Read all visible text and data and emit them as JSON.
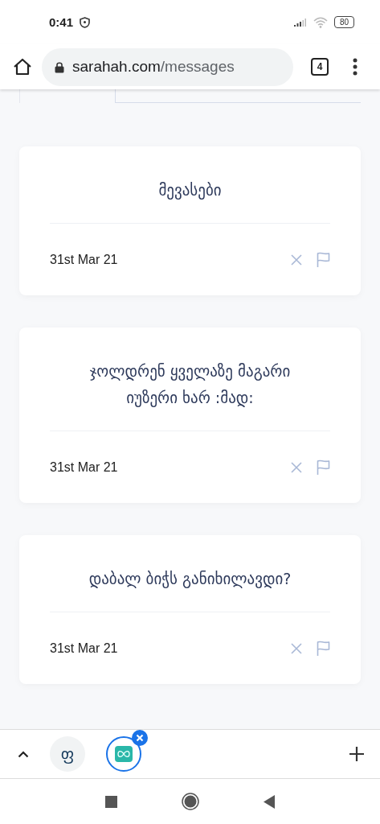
{
  "status_bar": {
    "time": "0:41",
    "battery": "80"
  },
  "address_bar": {
    "domain": "sarahah.com",
    "path": "/messages",
    "tab_count": "4"
  },
  "messages": [
    {
      "text": "მევასები",
      "date": "31st Mar 21"
    },
    {
      "text": "ჯოლდრენ ყველაზე მაგარი იუზერი ხარ :მად:",
      "date": "31st Mar 21"
    },
    {
      "text": "დაბალ ბიჭს განიხილავდი?",
      "date": "31st Mar 21"
    }
  ],
  "tab_strip": {
    "tabs": [
      {
        "kind": "letter",
        "label": "ფ",
        "selected": false
      },
      {
        "kind": "app",
        "selected": true
      }
    ]
  }
}
